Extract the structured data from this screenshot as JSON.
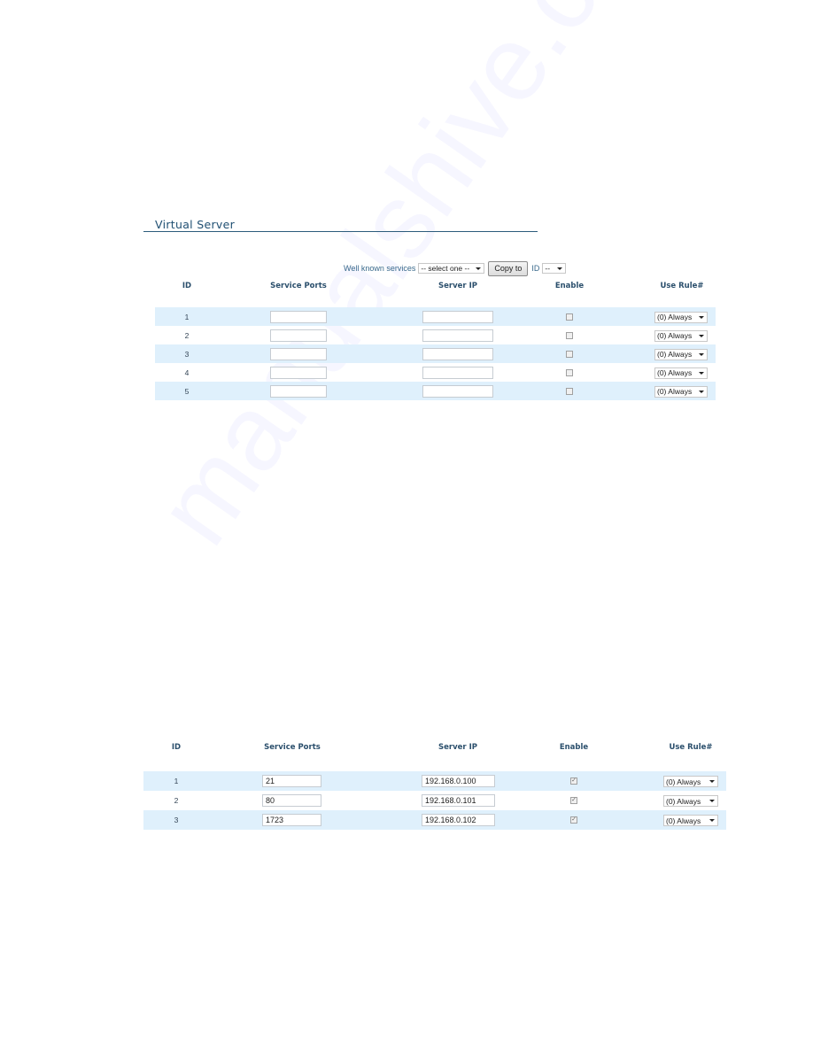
{
  "watermark": "manualshive.com",
  "section_title": "Virtual Server",
  "toolbar": {
    "well_known_label": "Well known services",
    "well_known_selected": "-- select one --",
    "copy_button": "Copy to",
    "id_label": "ID",
    "id_selected": "--"
  },
  "table_top": {
    "headers": [
      "ID",
      "Service Ports",
      "Server IP",
      "Enable",
      "Use Rule#"
    ],
    "rows": [
      {
        "id": "1",
        "ports": "",
        "ip": "",
        "enabled": false,
        "rule": "(0) Always"
      },
      {
        "id": "2",
        "ports": "",
        "ip": "",
        "enabled": false,
        "rule": "(0) Always"
      },
      {
        "id": "3",
        "ports": "",
        "ip": "",
        "enabled": false,
        "rule": "(0) Always"
      },
      {
        "id": "4",
        "ports": "",
        "ip": "",
        "enabled": false,
        "rule": "(0) Always"
      },
      {
        "id": "5",
        "ports": "",
        "ip": "",
        "enabled": false,
        "rule": "(0) Always"
      }
    ]
  },
  "table_bottom": {
    "headers": [
      "ID",
      "Service Ports",
      "Server IP",
      "Enable",
      "Use Rule#"
    ],
    "rows": [
      {
        "id": "1",
        "ports": "21",
        "ip": "192.168.0.100",
        "enabled": true,
        "rule": "(0) Always"
      },
      {
        "id": "2",
        "ports": "80",
        "ip": "192.168.0.101",
        "enabled": true,
        "rule": "(0) Always"
      },
      {
        "id": "3",
        "ports": "1723",
        "ip": "192.168.0.102",
        "enabled": true,
        "rule": "(0) Always"
      }
    ]
  },
  "colors": {
    "row_alt": "#dff0fc",
    "heading": "#1f4f72"
  }
}
